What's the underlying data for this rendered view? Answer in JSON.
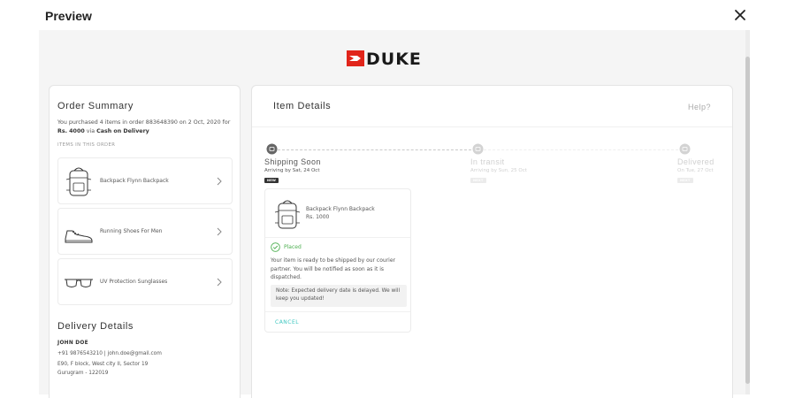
{
  "header": {
    "title": "Preview"
  },
  "brand": {
    "name": "DUKE",
    "logo_color": "#e1251b"
  },
  "order_summary": {
    "title": "Order Summary",
    "text_prefix": "You purchased 4 items in order 883648390 on 2 Oct, 2020 for",
    "amount": "Rs. 4000",
    "text_mid": "via",
    "payment": "Cash on Delivery",
    "items_heading": "ITEMS IN THIS ORDER",
    "items": [
      {
        "name": "Backpack Flynn Backpack",
        "icon": "backpack-icon"
      },
      {
        "name": "Running Shoes For Men",
        "icon": "shoe-icon"
      },
      {
        "name": "UV Protection Sunglasses",
        "icon": "sunglasses-icon"
      }
    ]
  },
  "delivery": {
    "title": "Delivery Details",
    "name": "JOHN DOE",
    "contact": "+91 9876543210 | john.doe@gmail.com",
    "address1": "E90, F block, West city II, Sector 19",
    "address2": "Gurugram - 122019"
  },
  "item_details": {
    "title": "Item Details",
    "help": "Help?",
    "steps": [
      {
        "label": "Shipping Soon",
        "sub": "Arriving by Sat, 24 Oct",
        "badge": "NEW",
        "active": true
      },
      {
        "label": "In transit",
        "sub": "Arriving by Sun, 25 Oct",
        "badge": "NEXT",
        "active": false
      },
      {
        "label": "Delivered",
        "sub": "On Tue, 27 Oct",
        "badge": "NEXT",
        "active": false
      }
    ],
    "card": {
      "product_name": "Backpack Flynn Backpack",
      "price": "Rs. 1000",
      "status": "Placed",
      "status_text": "Your item is ready to be shipped by our courier partner. You will be notified as soon as it is dispatched.",
      "note": "Note: Expected delivery date is delayed. We will keep you updated!",
      "cancel": "CANCEL"
    }
  },
  "colors": {
    "accent": "#3ec7c0",
    "success": "#4caf50",
    "brand_red": "#e1251b"
  }
}
